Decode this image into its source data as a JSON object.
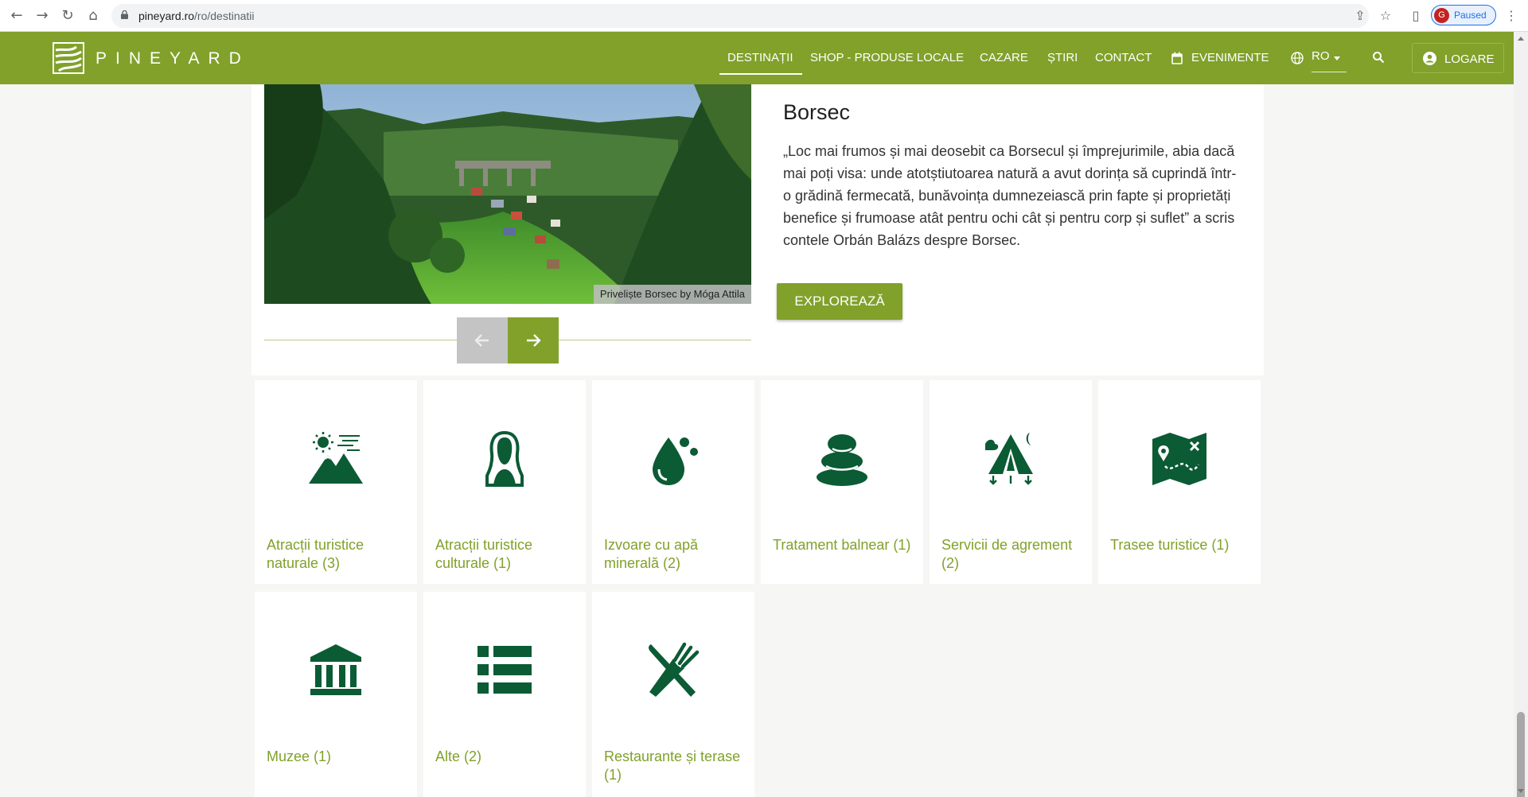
{
  "browser": {
    "url_host": "pineyard.ro",
    "url_path": "/ro/destinatii",
    "profile_initial": "G",
    "profile_status": "Paused"
  },
  "header": {
    "brand": "PINEYARD",
    "nav": {
      "destinatii": "DESTINAȚII",
      "shop": "SHOP - PRODUSE LOCALE",
      "cazare": "CAZARE",
      "stiri": "ȘTIRI",
      "contact": "CONTACT",
      "evenimente": "EVENIMENTE",
      "lang": "RO"
    },
    "login": "LOGARE",
    "colors": {
      "brand_green": "#81a12a",
      "icon_green": "#0b5b35"
    }
  },
  "destination": {
    "title": "Borsec",
    "description": "„Loc mai frumos și mai deosebit ca Borsecul și împrejurimile, abia dacă mai poți visa: unde atotștiutoarea natură a avut dorința să cuprindă într-o grădină fermecată, bunăvoința dumnezeiască prin fapte și proprietăți benefice și frumoase atât pentru ochi cât și pentru corp și suflet” a scris contele Orbán Balázs despre Borsec.",
    "photo_credit": "Priveliște Borsec by Móga Attila",
    "explore_label": "EXPLOREAZĂ"
  },
  "categories": [
    {
      "label": "Atracții turistice naturale (3)",
      "icon": "mountain-sun-icon"
    },
    {
      "label": "Atracții turistice culturale (1)",
      "icon": "statue-bust-icon"
    },
    {
      "label": "Izvoare cu apă minerală (2)",
      "icon": "water-drop-icon"
    },
    {
      "label": "Tratament balnear (1)",
      "icon": "spa-stones-icon"
    },
    {
      "label": "Servicii de agrement (2)",
      "icon": "camping-tent-icon"
    },
    {
      "label": "Trasee turistice (1)",
      "icon": "trail-map-icon"
    },
    {
      "label": "Muzee (1)",
      "icon": "museum-icon"
    },
    {
      "label": "Alte (2)",
      "icon": "list-icon"
    },
    {
      "label": "Restaurante și terase (1)",
      "icon": "fork-knife-icon"
    }
  ]
}
